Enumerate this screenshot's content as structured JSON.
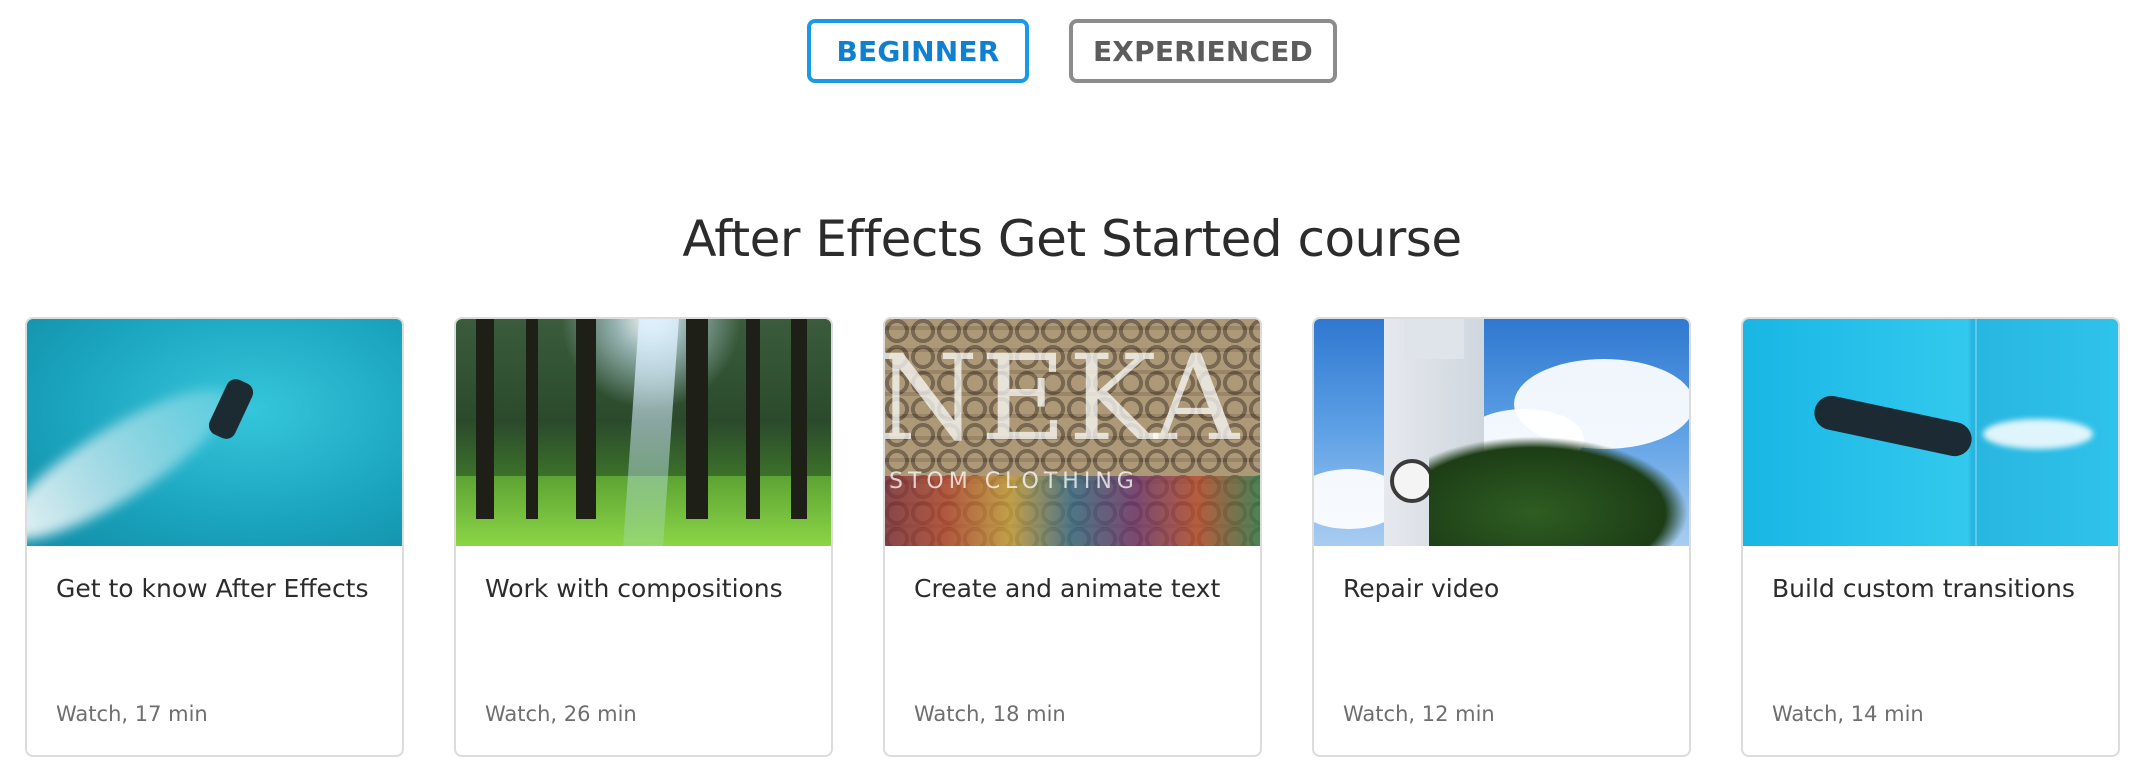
{
  "levels": {
    "beginner_label": "BEGINNER",
    "experienced_label": "EXPERIENCED",
    "selected": "BEGINNER",
    "colors": {
      "selected": "#1a9ae6",
      "unselected": "#8c8c8c"
    }
  },
  "course": {
    "title": "After Effects Get Started course",
    "cards": [
      {
        "title": "Get to know After Effects",
        "meta": "Watch, 17 min",
        "thumb_icon": "ocean-jetpack-image"
      },
      {
        "title": "Work with compositions",
        "meta": "Watch, 26 min",
        "thumb_icon": "forest-image"
      },
      {
        "title": "Create and animate text",
        "meta": "Watch, 18 min",
        "thumb_icon": "fabric-rolls-image",
        "overlay_big": "NEKA",
        "overlay_small": "STOM CLOTHING"
      },
      {
        "title": "Repair video",
        "meta": "Watch, 12 min",
        "thumb_icon": "clock-tower-image"
      },
      {
        "title": "Build custom transitions",
        "meta": "Watch, 14 min",
        "thumb_icon": "underwater-image"
      }
    ]
  }
}
